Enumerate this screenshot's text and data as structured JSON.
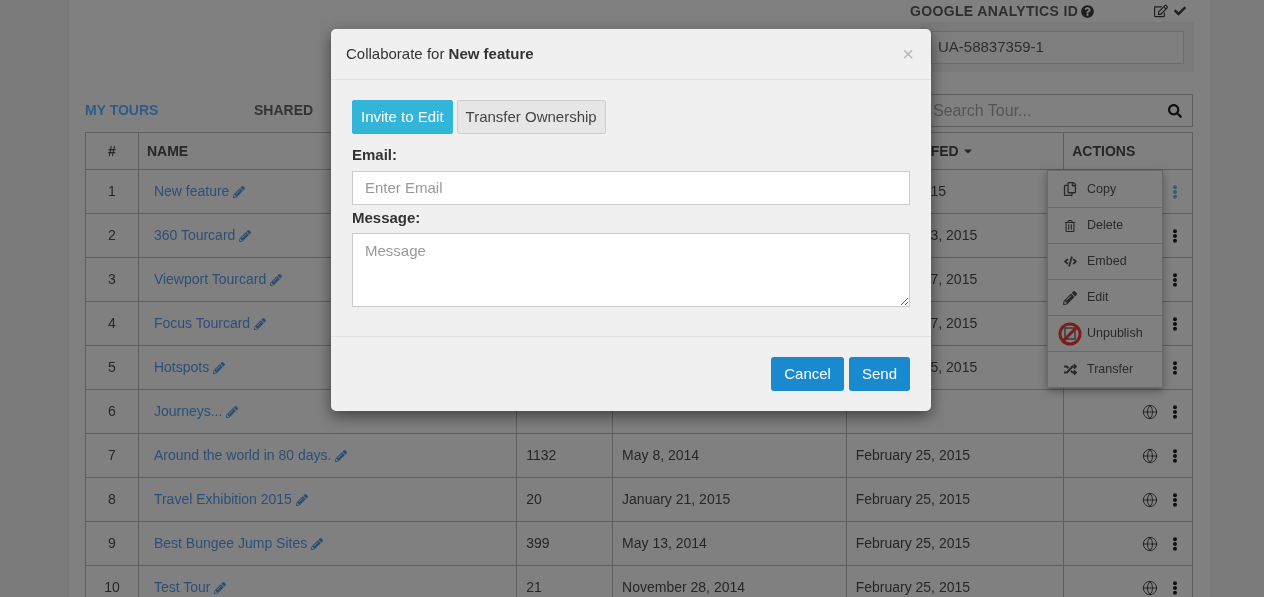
{
  "analytics": {
    "label": "GOOGLE ANALYTICS ID",
    "value": "UA-58837359-1"
  },
  "tabs": [
    {
      "label": "MY TOURS",
      "selected": true
    },
    {
      "label": "SHARED",
      "selected": false
    }
  ],
  "search": {
    "placeholder": "Search Tour..."
  },
  "table": {
    "columns": [
      "#",
      "NAME",
      "FED",
      "ACTIONS"
    ],
    "rows": [
      {
        "num": "1",
        "name": "New feature",
        "modified": "15",
        "menu_open": true
      },
      {
        "num": "2",
        "name": "360 Tourcard",
        "modified": "3, 2015",
        "menu_open": false
      },
      {
        "num": "3",
        "name": "Viewport Tourcard",
        "modified": "7, 2015",
        "menu_open": false
      },
      {
        "num": "4",
        "name": "Focus Tourcard",
        "modified": "7, 2015",
        "menu_open": false
      },
      {
        "num": "5",
        "name": "Hotspots",
        "modified": "5, 2015",
        "menu_open": false
      },
      {
        "num": "6",
        "name": "Journeys...",
        "menu_open": false
      },
      {
        "num": "7",
        "name": "Around the world in 80 days.",
        "views": "1132",
        "created": "May 8, 2014",
        "modified": "February 25, 2015",
        "menu_open": false
      },
      {
        "num": "8",
        "name": "Travel Exhibition 2015",
        "views": "20",
        "created": "January 21, 2015",
        "modified": "February 25, 2015",
        "menu_open": false
      },
      {
        "num": "9",
        "name": "Best Bungee Jump Sites",
        "views": "399",
        "created": "May 13, 2014",
        "modified": "February 25, 2015",
        "menu_open": false
      },
      {
        "num": "10",
        "name": "Test Tour",
        "views": "21",
        "created": "November 28, 2014",
        "modified": "February 25, 2015",
        "menu_open": false
      }
    ]
  },
  "menu": [
    {
      "kind": "copy",
      "label": "Copy"
    },
    {
      "kind": "delete",
      "label": "Delete"
    },
    {
      "kind": "embed",
      "label": "Embed"
    },
    {
      "kind": "edit",
      "label": "Edit"
    },
    {
      "kind": "unpublish",
      "label": "Unpublish"
    },
    {
      "kind": "transfer",
      "label": "Transfer"
    }
  ],
  "dialog": {
    "title": "Collaborate for **New feature**",
    "tabs": [
      {
        "label": "Invite to Edit",
        "selected": true
      },
      {
        "label": "Transfer Ownership",
        "selected": false
      }
    ],
    "email_label": "Email:",
    "email_placeholder": "Enter Email",
    "message_label": "Message:",
    "message_placeholder": "Message",
    "close": "×",
    "buttons": [
      "Cancel",
      "Send"
    ]
  }
}
